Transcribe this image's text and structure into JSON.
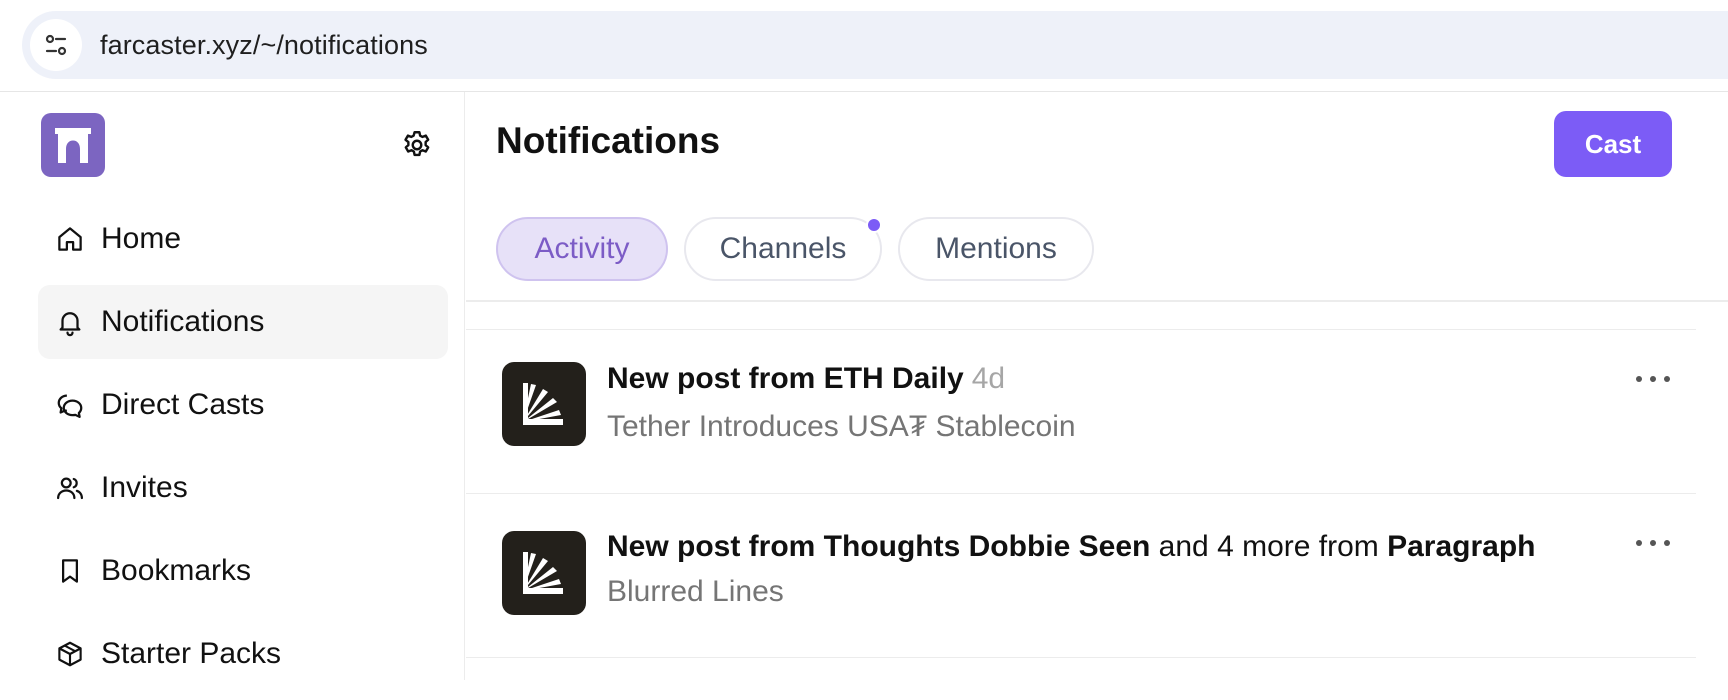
{
  "browser": {
    "url": "farcaster.xyz/~/notifications"
  },
  "sidebar": {
    "items": [
      {
        "label": "Home",
        "icon": "home-icon"
      },
      {
        "label": "Notifications",
        "icon": "bell-icon",
        "active": true
      },
      {
        "label": "Direct Casts",
        "icon": "chat-bubbles-icon"
      },
      {
        "label": "Invites",
        "icon": "users-icon"
      },
      {
        "label": "Bookmarks",
        "icon": "bookmark-icon"
      },
      {
        "label": "Starter Packs",
        "icon": "box-icon"
      }
    ]
  },
  "main": {
    "title": "Notifications",
    "cast_label": "Cast",
    "tabs": [
      {
        "label": "Activity",
        "active": true
      },
      {
        "label": "Channels",
        "unread": true
      },
      {
        "label": "Mentions"
      }
    ],
    "notifications": [
      {
        "prefix": "New post from ETH Daily",
        "time": "4d",
        "subtitle": "Tether Introduces USA₮ Stablecoin"
      },
      {
        "prefix": "New post from Thoughts Dobbie Seen",
        "middle": " and 4 more from ",
        "source": "Paragraph",
        "subtitle": "Blurred Lines"
      }
    ]
  },
  "colors": {
    "brand": "#7c65c1",
    "accent": "#7c5cf6",
    "active_tab_bg": "#e7e1f8"
  }
}
